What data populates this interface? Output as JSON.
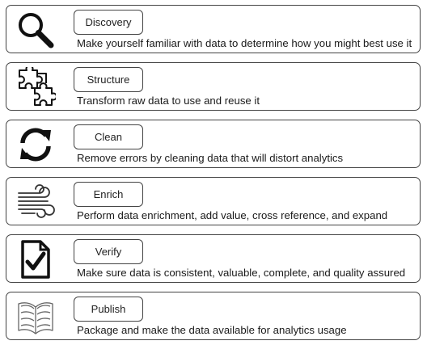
{
  "steps": [
    {
      "title": "Discovery",
      "description": "Make yourself familiar with data to determine how you might best use it",
      "icon": "magnifier-icon"
    },
    {
      "title": "Structure",
      "description": "Transform raw data to use and reuse it",
      "icon": "puzzle-icon"
    },
    {
      "title": "Clean",
      "description": "Remove errors by cleaning data that will distort analytics",
      "icon": "refresh-icon"
    },
    {
      "title": "Enrich",
      "description": "Perform data enrichment, add value, cross reference, and expand",
      "icon": "wind-icon"
    },
    {
      "title": "Verify",
      "description": "Make sure data is consistent, valuable, complete, and quality assured",
      "icon": "checked-document-icon"
    },
    {
      "title": "Publish",
      "description": "Package and make the data available for analytics usage",
      "icon": "open-book-icon"
    }
  ]
}
